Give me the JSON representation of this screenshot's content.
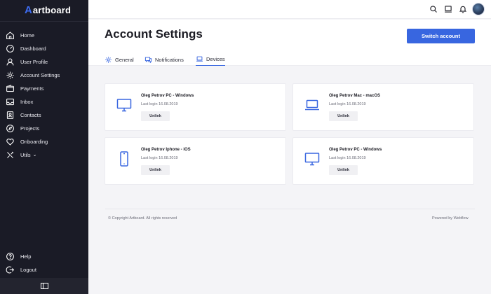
{
  "brand": {
    "mark": "A",
    "name": "artboard",
    "accent": "#3d6cf2"
  },
  "sidebar": {
    "items": [
      {
        "label": "Home",
        "icon": "home-icon"
      },
      {
        "label": "Dashboard",
        "icon": "dashboard-icon"
      },
      {
        "label": "User Profile",
        "icon": "user-icon"
      },
      {
        "label": "Account Settings",
        "icon": "gear-icon"
      },
      {
        "label": "Payments",
        "icon": "wallet-icon"
      },
      {
        "label": "Inbox",
        "icon": "inbox-icon"
      },
      {
        "label": "Contacts",
        "icon": "contacts-icon"
      },
      {
        "label": "Projects",
        "icon": "rocket-icon"
      },
      {
        "label": "Onboarding",
        "icon": "heart-icon"
      },
      {
        "label": "Utils",
        "icon": "tools-icon",
        "chevron": "⌄"
      }
    ],
    "bottom_items": [
      {
        "label": "Help",
        "icon": "help-icon"
      },
      {
        "label": "Logout",
        "icon": "logout-icon"
      }
    ],
    "collapse_icon": "sidebar-toggle-icon"
  },
  "topbar": {
    "icons": [
      "search-icon",
      "monitor-icon",
      "bell-icon"
    ],
    "avatar": "user-avatar"
  },
  "header": {
    "title": "Account Settings",
    "switch_button": "Switch account",
    "tabs": [
      {
        "label": "General",
        "icon": "gear-icon"
      },
      {
        "label": "Notifications",
        "icon": "chat-icon"
      },
      {
        "label": "Devices",
        "icon": "devices-icon",
        "active": true
      }
    ]
  },
  "devices": [
    {
      "name": "Oleg Petrov PC - Windows",
      "last_login": "Last login 16.08.2019",
      "action": "Unlink",
      "icon": "desktop-icon"
    },
    {
      "name": "Oleg Petrov Mac - macOS",
      "last_login": "Last login 16.08.2019",
      "action": "Unlink",
      "icon": "laptop-icon"
    },
    {
      "name": "Oleg Petrov Iphone - iOS",
      "last_login": "Last login 16.08.2019",
      "action": "Unlink",
      "icon": "phone-icon"
    },
    {
      "name": "Oleg Petrov PC - Windows",
      "last_login": "Last login 16.08.2019",
      "action": "Unlink",
      "icon": "desktop-icon"
    }
  ],
  "footer": {
    "copyright": "© Copyright Artboard. All rights reserved",
    "powered": "Powered by Webflow"
  },
  "colors": {
    "primary": "#3866e0",
    "sidebar_bg": "#1a1b26",
    "page_bg": "#f4f4f7"
  }
}
